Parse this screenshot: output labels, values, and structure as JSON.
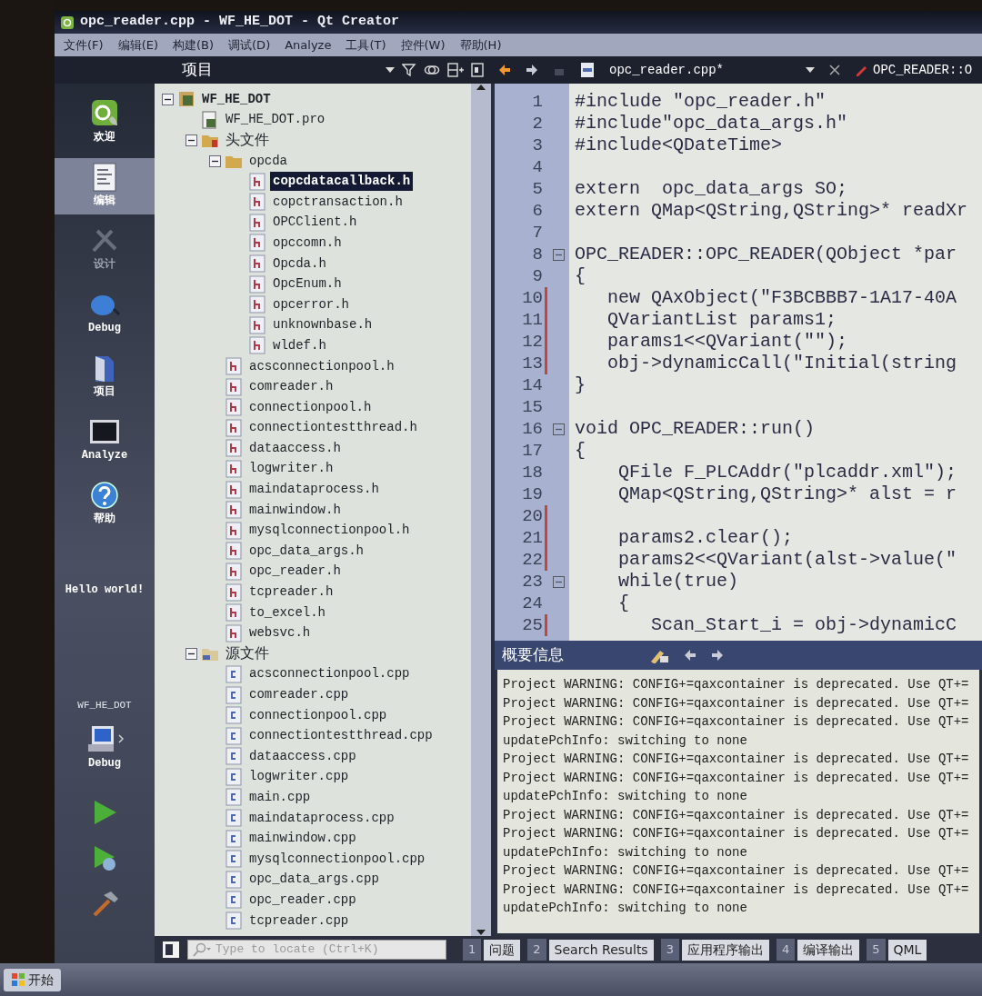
{
  "window": {
    "title": "opc_reader.cpp - WF_HE_DOT - Qt Creator"
  },
  "menu": [
    "文件(F)",
    "编辑(E)",
    "构建(B)",
    "调试(D)",
    "Analyze",
    "工具(T)",
    "控件(W)",
    "帮助(H)"
  ],
  "toolbar": {
    "panel_title": "项目",
    "document": "opc_reader.cpp*",
    "symbol": "OPC_READER::O"
  },
  "mode_bar": {
    "modes": [
      {
        "label": "欢迎",
        "kind": "welcome",
        "selected": false,
        "disabled": false
      },
      {
        "label": "编辑",
        "kind": "edit",
        "selected": true,
        "disabled": false
      },
      {
        "label": "设计",
        "kind": "design",
        "selected": false,
        "disabled": true
      },
      {
        "label": "Debug",
        "kind": "debug",
        "selected": false,
        "disabled": false
      },
      {
        "label": "项目",
        "kind": "projects",
        "selected": false,
        "disabled": false
      },
      {
        "label": "Analyze",
        "kind": "analyze",
        "selected": false,
        "disabled": false
      },
      {
        "label": "帮助",
        "kind": "help",
        "selected": false,
        "disabled": false
      }
    ],
    "session": "Hello world!",
    "project": "WF_HE_DOT",
    "target": "Debug"
  },
  "project_tree": [
    {
      "label": "WF_HE_DOT",
      "kind": "project",
      "expanded": true,
      "selected": false,
      "children": [
        {
          "label": "WF_HE_DOT.pro",
          "kind": "pro",
          "selected": false
        },
        {
          "label": "头文件",
          "kind": "headers",
          "expanded": true,
          "selected": false,
          "children": [
            {
              "label": "opcda",
              "kind": "folder",
              "expanded": true,
              "selected": false,
              "children": [
                {
                  "label": "copcdatacallback.h",
                  "kind": "header",
                  "selected": true
                },
                {
                  "label": "copctransaction.h",
                  "kind": "header",
                  "selected": false
                },
                {
                  "label": "OPCClient.h",
                  "kind": "header",
                  "selected": false
                },
                {
                  "label": "opccomn.h",
                  "kind": "header",
                  "selected": false
                },
                {
                  "label": "Opcda.h",
                  "kind": "header",
                  "selected": false
                },
                {
                  "label": "OpcEnum.h",
                  "kind": "header",
                  "selected": false
                },
                {
                  "label": "opcerror.h",
                  "kind": "header",
                  "selected": false
                },
                {
                  "label": "unknownbase.h",
                  "kind": "header",
                  "selected": false
                },
                {
                  "label": "wldef.h",
                  "kind": "header",
                  "selected": false
                }
              ]
            },
            {
              "label": "acsconnectionpool.h",
              "kind": "header",
              "selected": false
            },
            {
              "label": "comreader.h",
              "kind": "header",
              "selected": false
            },
            {
              "label": "connectionpool.h",
              "kind": "header",
              "selected": false
            },
            {
              "label": "connectiontestthread.h",
              "kind": "header",
              "selected": false
            },
            {
              "label": "dataaccess.h",
              "kind": "header",
              "selected": false
            },
            {
              "label": "logwriter.h",
              "kind": "header",
              "selected": false
            },
            {
              "label": "maindataprocess.h",
              "kind": "header",
              "selected": false
            },
            {
              "label": "mainwindow.h",
              "kind": "header",
              "selected": false
            },
            {
              "label": "mysqlconnectionpool.h",
              "kind": "header",
              "selected": false
            },
            {
              "label": "opc_data_args.h",
              "kind": "header",
              "selected": false
            },
            {
              "label": "opc_reader.h",
              "kind": "header",
              "selected": false
            },
            {
              "label": "tcpreader.h",
              "kind": "header",
              "selected": false
            },
            {
              "label": "to_excel.h",
              "kind": "header",
              "selected": false
            },
            {
              "label": "websvc.h",
              "kind": "header",
              "selected": false
            }
          ]
        },
        {
          "label": "源文件",
          "kind": "sources",
          "expanded": true,
          "selected": false,
          "children": [
            {
              "label": "acsconnectionpool.cpp",
              "kind": "source",
              "selected": false
            },
            {
              "label": "comreader.cpp",
              "kind": "source",
              "selected": false
            },
            {
              "label": "connectionpool.cpp",
              "kind": "source",
              "selected": false
            },
            {
              "label": "connectiontestthread.cpp",
              "kind": "source",
              "selected": false
            },
            {
              "label": "dataaccess.cpp",
              "kind": "source",
              "selected": false
            },
            {
              "label": "logwriter.cpp",
              "kind": "source",
              "selected": false
            },
            {
              "label": "main.cpp",
              "kind": "source",
              "selected": false
            },
            {
              "label": "maindataprocess.cpp",
              "kind": "source",
              "selected": false
            },
            {
              "label": "mainwindow.cpp",
              "kind": "source",
              "selected": false
            },
            {
              "label": "mysqlconnectionpool.cpp",
              "kind": "source",
              "selected": false
            },
            {
              "label": "opc_data_args.cpp",
              "kind": "source",
              "selected": false
            },
            {
              "label": "opc_reader.cpp",
              "kind": "source",
              "selected": false
            },
            {
              "label": "tcpreader.cpp",
              "kind": "source",
              "selected": false
            }
          ]
        }
      ]
    }
  ],
  "locator": {
    "placeholder": "Type to locate (Ctrl+K)"
  },
  "editor": {
    "lines": [
      {
        "number": "1",
        "text": "#include \"opc_reader.h\"",
        "changed": false,
        "foldable": false
      },
      {
        "number": "2",
        "text": "#include\"opc_data_args.h\"",
        "changed": false,
        "foldable": false
      },
      {
        "number": "3",
        "text": "#include<QDateTime>",
        "changed": false,
        "foldable": false
      },
      {
        "number": "4",
        "changed": false,
        "foldable": false
      },
      {
        "number": "5",
        "text": "extern  opc_data_args SO;",
        "changed": false,
        "foldable": false
      },
      {
        "number": "6",
        "text": "extern QMap<QString,QString>* readXr",
        "changed": false,
        "foldable": false
      },
      {
        "number": "7",
        "changed": false,
        "foldable": false
      },
      {
        "number": "8",
        "text": "OPC_READER::OPC_READER(QObject *par",
        "changed": false,
        "foldable": true
      },
      {
        "number": "9",
        "text": "{",
        "changed": false,
        "foldable": false
      },
      {
        "number": "10",
        "text": "   new QAxObject(\"F3BCBBB7-1A17-40A",
        "changed": true,
        "foldable": false
      },
      {
        "number": "11",
        "text": "   QVariantList params1;",
        "changed": true,
        "foldable": false
      },
      {
        "number": "12",
        "text": "   params1<<QVariant(\"\");",
        "changed": true,
        "foldable": false
      },
      {
        "number": "13",
        "text": "   obj->dynamicCall(\"Initial(string",
        "changed": true,
        "foldable": false
      },
      {
        "number": "14",
        "text": "}",
        "changed": false,
        "foldable": false
      },
      {
        "number": "15",
        "changed": false,
        "foldable": false
      },
      {
        "number": "16",
        "text": "void OPC_READER::run()",
        "changed": false,
        "foldable": true
      },
      {
        "number": "17",
        "text": "{",
        "changed": false,
        "foldable": false
      },
      {
        "number": "18",
        "text": "    QFile F_PLCAddr(\"plcaddr.xml\");",
        "changed": false,
        "foldable": false
      },
      {
        "number": "19",
        "text": "    QMap<QString,QString>* alst = r",
        "changed": false,
        "foldable": false
      },
      {
        "number": "20",
        "changed": true,
        "foldable": false
      },
      {
        "number": "21",
        "text": "    params2.clear();",
        "changed": true,
        "foldable": false
      },
      {
        "number": "22",
        "text": "    params2<<QVariant(alst->value(\"",
        "changed": true,
        "foldable": false
      },
      {
        "number": "23",
        "text": "    while(true)",
        "changed": false,
        "foldable": true
      },
      {
        "number": "24",
        "text": "    {",
        "changed": false,
        "foldable": false
      },
      {
        "number": "25",
        "text": "       Scan_Start_i = obj->dynamicC",
        "changed": true,
        "foldable": false
      }
    ]
  },
  "output": {
    "title": "概要信息",
    "lines": [
      "Project WARNING: CONFIG+=qaxcontainer is deprecated. Use QT+=",
      "Project WARNING: CONFIG+=qaxcontainer is deprecated. Use QT+=",
      "Project WARNING: CONFIG+=qaxcontainer is deprecated. Use QT+=",
      "updatePchInfo: switching to none",
      "Project WARNING: CONFIG+=qaxcontainer is deprecated. Use QT+=",
      "Project WARNING: CONFIG+=qaxcontainer is deprecated. Use QT+=",
      "updatePchInfo: switching to none",
      "Project WARNING: CONFIG+=qaxcontainer is deprecated. Use QT+=",
      "Project WARNING: CONFIG+=qaxcontainer is deprecated. Use QT+=",
      "updatePchInfo: switching to none",
      "Project WARNING: CONFIG+=qaxcontainer is deprecated. Use QT+=",
      "Project WARNING: CONFIG+=qaxcontainer is deprecated. Use QT+=",
      "updatePchInfo: switching to none"
    ]
  },
  "output_tabs": [
    {
      "number": "1",
      "label": "问题"
    },
    {
      "number": "2",
      "label": "Search Results"
    },
    {
      "number": "3",
      "label": "应用程序输出"
    },
    {
      "number": "4",
      "label": "编译输出"
    },
    {
      "number": "5",
      "label": "QML"
    }
  ],
  "taskbar": {
    "start": "开始"
  }
}
